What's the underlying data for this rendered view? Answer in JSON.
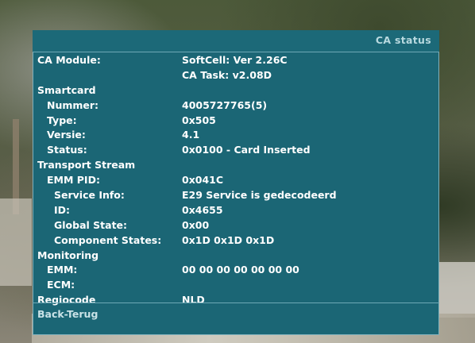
{
  "header": {
    "title": "CA status"
  },
  "rows": [
    {
      "label": "CA Module:",
      "value": "SoftCell: Ver 2.26C",
      "level": 0
    },
    {
      "label": "",
      "value": "CA Task: v2.08D",
      "level": 0
    },
    {
      "label": "Smartcard",
      "value": "",
      "level": 0
    },
    {
      "label": "Nummer:",
      "value": "4005727765(5)",
      "level": 1
    },
    {
      "label": "Type:",
      "value": "0x505",
      "level": 1
    },
    {
      "label": "Versie:",
      "value": "4.1",
      "level": 1
    },
    {
      "label": "Status:",
      "value": "0x0100 - Card Inserted",
      "level": 1
    },
    {
      "label": "Transport Stream",
      "value": "",
      "level": 0
    },
    {
      "label": "EMM PID:",
      "value": "0x041C",
      "level": 1
    },
    {
      "label": "Service Info:",
      "value": "E29 Service is gedecodeerd",
      "level": 2
    },
    {
      "label": "ID:",
      "value": "0x4655",
      "level": 2
    },
    {
      "label": "Global State:",
      "value": "0x00",
      "level": 2
    },
    {
      "label": "Component States:",
      "value": "0x1D 0x1D 0x1D",
      "level": 2
    },
    {
      "label": "Monitoring",
      "value": "",
      "level": 0
    },
    {
      "label": "EMM:",
      "value": "00 00 00 00 00 00 00",
      "level": 1
    },
    {
      "label": "ECM:",
      "value": "",
      "level": 1
    },
    {
      "label": "Regiocode",
      "value": "NLD",
      "level": 0
    }
  ],
  "footer": {
    "back_label": "Back-Terug"
  },
  "colors": {
    "panel": "#1b6675",
    "text": "#ffffff",
    "title": "#b8d9df",
    "border": "#6ea8b5"
  }
}
